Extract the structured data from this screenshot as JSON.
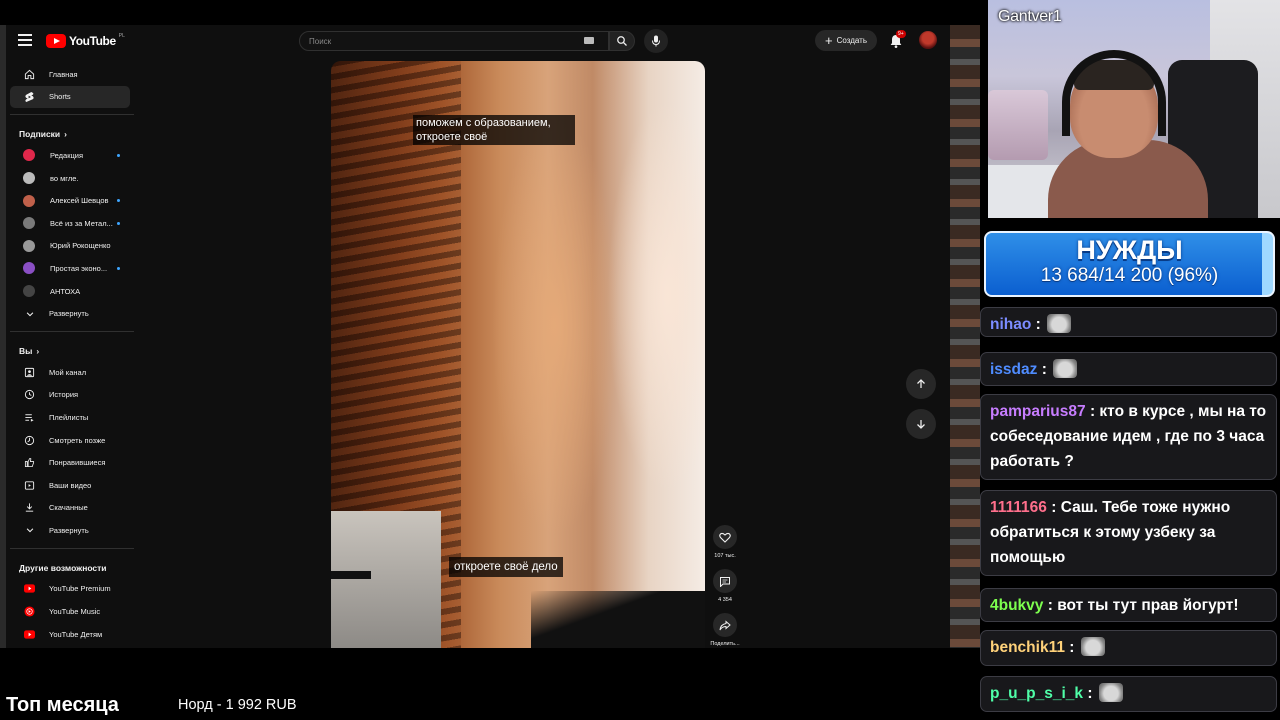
{
  "youtube": {
    "logo_text": "YouTube",
    "logo_country": "PL",
    "search_placeholder": "Поиск",
    "create_label": "Создать",
    "notifications_badge": "9+",
    "sidebar": {
      "main": [
        {
          "label": "Главная",
          "icon": "home-icon"
        },
        {
          "label": "Shorts",
          "icon": "shorts-icon",
          "active": true
        }
      ],
      "subscriptions_header": "Подписки",
      "subscriptions": [
        {
          "label": "Редакция",
          "dot": true,
          "color": "#e0284b"
        },
        {
          "label": "во мгле.",
          "dot": false,
          "color": "#bbbbbb"
        },
        {
          "label": "Алексей Шевцов",
          "dot": true,
          "color": "#c0604a"
        },
        {
          "label": "Всё из за Метал...",
          "dot": true,
          "color": "#7a7a7a"
        },
        {
          "label": "Юрий Рокощенко",
          "dot": false,
          "color": "#999999"
        },
        {
          "label": "Простая эконо...",
          "dot": true,
          "color": "#8a4fc4"
        },
        {
          "label": "АНТОХА",
          "dot": false,
          "color": "#444444"
        }
      ],
      "subscriptions_expand": "Развернуть",
      "you_header": "Вы",
      "you_items": [
        {
          "label": "Мой канал",
          "icon": "channel-icon"
        },
        {
          "label": "История",
          "icon": "history-icon"
        },
        {
          "label": "Плейлисты",
          "icon": "playlists-icon"
        },
        {
          "label": "Смотреть позже",
          "icon": "watch-later-icon"
        },
        {
          "label": "Понравившиеся",
          "icon": "like-icon"
        },
        {
          "label": "Ваши видео",
          "icon": "your-videos-icon"
        },
        {
          "label": "Скачанные",
          "icon": "download-icon"
        }
      ],
      "you_expand": "Развернуть",
      "more_header": "Другие возможности",
      "more_items": [
        {
          "label": "YouTube Premium",
          "icon": "youtube-premium-icon"
        },
        {
          "label": "YouTube Music",
          "icon": "youtube-music-icon"
        },
        {
          "label": "YouTube Детям",
          "icon": "youtube-kids-icon"
        }
      ]
    },
    "video": {
      "caption_top": "поможем с образованием, откроете своё",
      "caption_bottom": "откроете своё дело"
    },
    "actions": {
      "likes": "107 тыс.",
      "comments": "4 354",
      "share": "Поделить..."
    }
  },
  "stream": {
    "streamer_name": "Gantver1",
    "goal": {
      "title": "НУЖДЫ",
      "current": "13 684",
      "target": "14 200",
      "percent_label": "(96%)",
      "progress": 0.96
    },
    "chat": [
      {
        "user": "nihao",
        "color": "#7b8cff",
        "text": "",
        "emote": true
      },
      {
        "user": "issdaz",
        "color": "#4f8cff",
        "text": "",
        "emote": true
      },
      {
        "user": "pamparius87",
        "color": "#c77dff",
        "text": "кто в курсе , мы на то собеседование идем , где по 3 часа работать ?",
        "emote": false
      },
      {
        "user": "1111166",
        "color": "#ff6f8c",
        "text": "Саш. Тебе тоже нужно обратиться к этому узбеку за помощью",
        "emote": false
      },
      {
        "user": "4bukvy",
        "color": "#7dff4f",
        "text": "вот ты тут прав йогурт!",
        "emote": false
      },
      {
        "user": "benchik11",
        "color": "#ffd27a",
        "text": "",
        "emote": true
      },
      {
        "user": "p_u_p_s_i_k",
        "color": "#4fffa8",
        "text": "",
        "emote": true
      }
    ],
    "bottom_left": "Топ месяца",
    "bottom_mid": "Норд - 1 992 RUB"
  }
}
